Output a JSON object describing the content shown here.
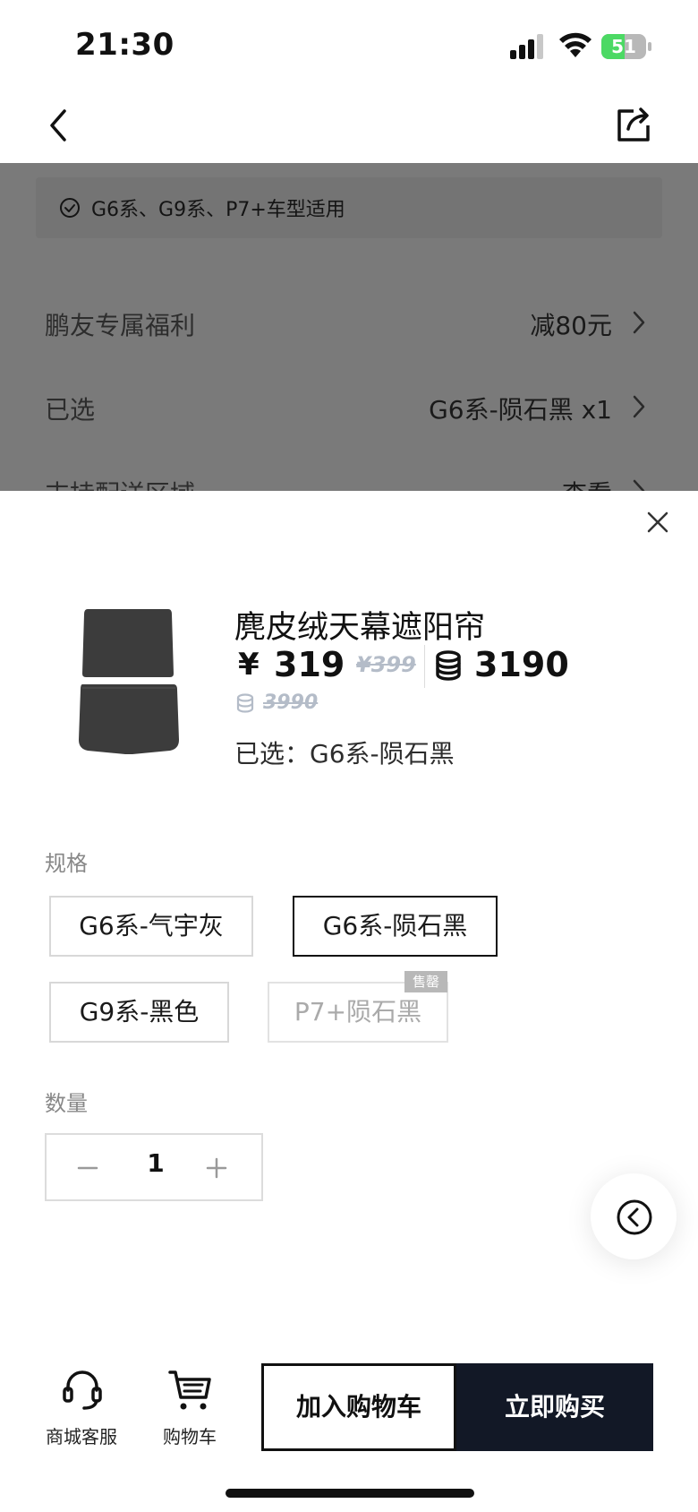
{
  "status_bar": {
    "time": "21:30",
    "battery_level": "51",
    "battery_fraction": 0.51
  },
  "overlay": {
    "compat_text": "G6系、G9系、P7+车型适用",
    "rows": [
      {
        "label": "鹏友专属福利",
        "value": "减80元"
      },
      {
        "label": "已选",
        "value": "G6系-陨石黑 x1"
      },
      {
        "label": "支持配送区域",
        "value": "查看"
      }
    ]
  },
  "product": {
    "title": "麂皮绒天幕遮阳帘",
    "currency": "¥",
    "price": "319",
    "original_price": "¥399",
    "coin_price": "3190",
    "coin_original_price": "3990",
    "selected_text": "已选：G6系-陨石黑"
  },
  "spec": {
    "label": "规格",
    "options": [
      {
        "label": "G6系-气宇灰",
        "state": "normal"
      },
      {
        "label": "G6系-陨石黑",
        "state": "selected"
      },
      {
        "label": "G9系-黑色",
        "state": "normal"
      },
      {
        "label": "P7+陨石黑",
        "state": "sold_out"
      }
    ],
    "sold_out_badge": "售罄"
  },
  "quantity": {
    "label": "数量",
    "value": "1"
  },
  "bottom_bar": {
    "service_label": "商城客服",
    "cart_label": "购物车",
    "add_to_cart": "加入购物车",
    "buy_now": "立即购买"
  },
  "icons": {
    "back": "chevron-left-icon",
    "share": "share-icon",
    "close": "close-icon",
    "coin": "coin-stack-icon",
    "service": "headset-icon",
    "cart": "cart-icon",
    "float": "collapse-arrow-icon"
  },
  "colors": {
    "primary_dark": "#121826",
    "overlay": "#7a7a7a",
    "muted_price": "#b4bcc8",
    "battery_green": "#4cd964"
  }
}
